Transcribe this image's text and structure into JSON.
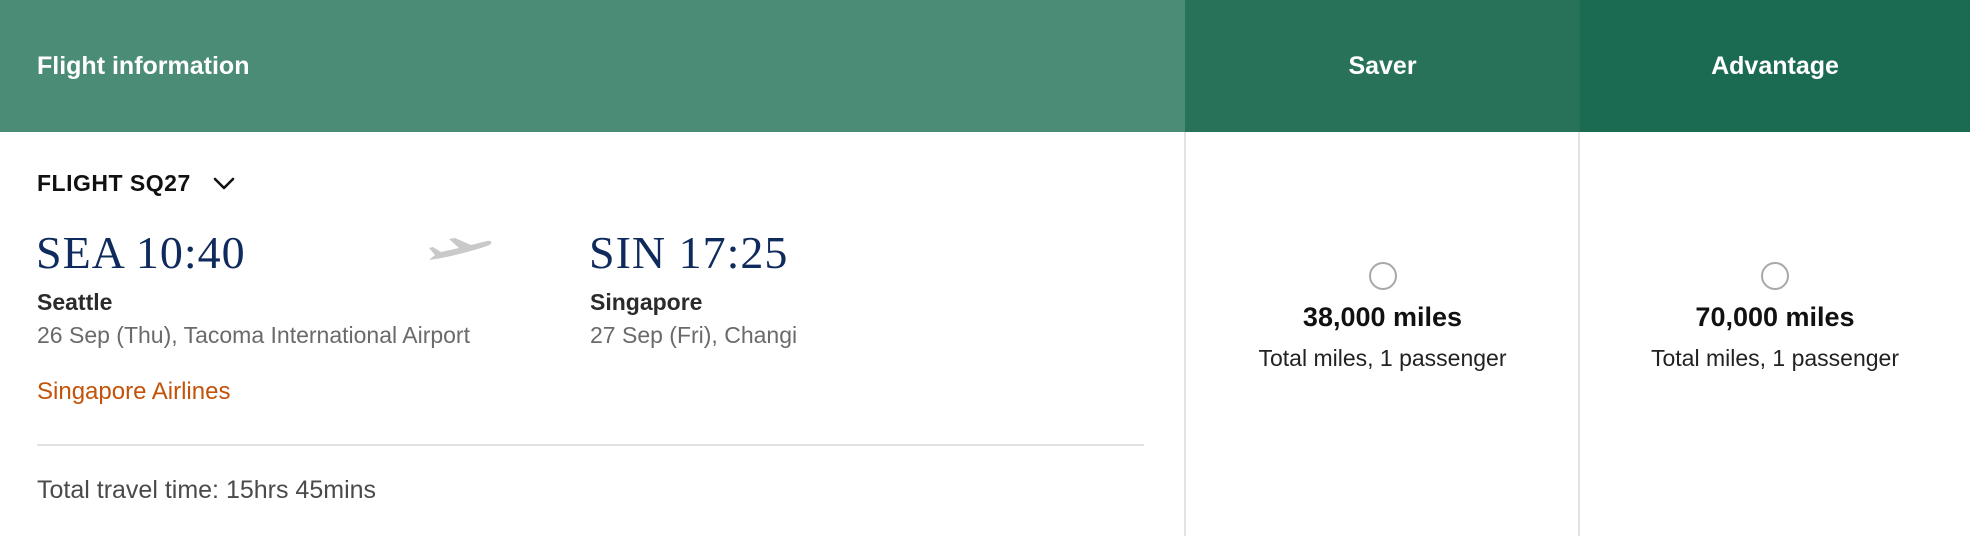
{
  "header": {
    "flight_info": "Flight information",
    "saver": "Saver",
    "advantage": "Advantage"
  },
  "flight": {
    "number": "FLIGHT SQ27",
    "toggle_icon": "chevron-down-icon",
    "plane_icon": "plane-icon",
    "departure": {
      "code_time": "SEA 10:40",
      "city": "Seattle",
      "detail": "26 Sep (Thu), Tacoma International Airport"
    },
    "arrival": {
      "code_time": "SIN 17:25",
      "city": "Singapore",
      "detail": "27 Sep (Fri), Changi"
    },
    "airline": "Singapore Airlines",
    "total_travel": "Total travel time: 15hrs 45mins"
  },
  "fares": {
    "saver": {
      "miles": "38,000 miles",
      "subtitle": "Total miles, 1 passenger"
    },
    "advantage": {
      "miles": "70,000 miles",
      "subtitle": "Total miles, 1 passenger"
    }
  },
  "colors": {
    "header_info": "#4b8c77",
    "header_saver": "#287259",
    "header_advantage": "#1b6b53",
    "airport_code": "#0f2a5c",
    "airline": "#c45208"
  }
}
